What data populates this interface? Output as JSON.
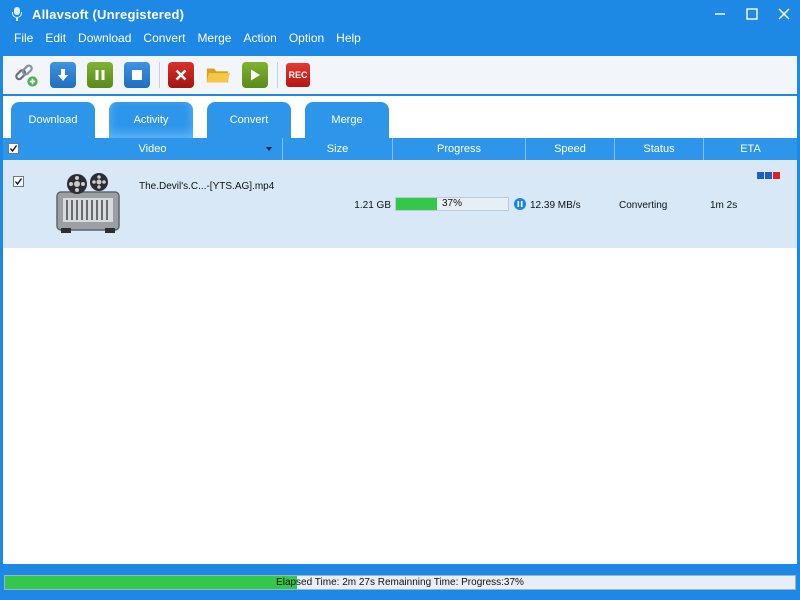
{
  "window": {
    "title": "Allavsoft (Unregistered)",
    "controls": [
      "minimize",
      "maximize",
      "close"
    ]
  },
  "menu": [
    "File",
    "Edit",
    "Download",
    "Convert",
    "Merge",
    "Action",
    "Option",
    "Help"
  ],
  "toolbar": {
    "buttons": [
      {
        "icon": "link-add-icon"
      },
      {
        "icon": "download-icon"
      },
      {
        "icon": "pause-icon"
      },
      {
        "icon": "stop-icon"
      },
      {
        "icon": "delete-icon"
      },
      {
        "icon": "folder-icon"
      },
      {
        "icon": "play-icon"
      },
      {
        "icon": "record-icon",
        "label": "REC"
      }
    ]
  },
  "tabs": [
    "Download",
    "Activity",
    "Convert",
    "Merge"
  ],
  "active_tab": "Activity",
  "table": {
    "columns": [
      "Video",
      "Size",
      "Progress",
      "Speed",
      "Status",
      "ETA"
    ],
    "rows": [
      {
        "checked": true,
        "filename": "The.Devil's.C...-[YTS.AG].mp4",
        "size": "1.21 GB",
        "progress_text": "37%",
        "progress": 37,
        "speed": "12.39 MB/s",
        "status": "Converting",
        "eta": "1m  2s"
      }
    ]
  },
  "statusbar": {
    "text": "Elapsed Time: 2m 27s Remainning Time: Progress:37%",
    "progress": 37
  },
  "colors": {
    "titlebar": "#1e88e5",
    "tab": "#2e96ea",
    "row_selected": "#d8e8f7",
    "progress_fill": "#33c84a"
  }
}
